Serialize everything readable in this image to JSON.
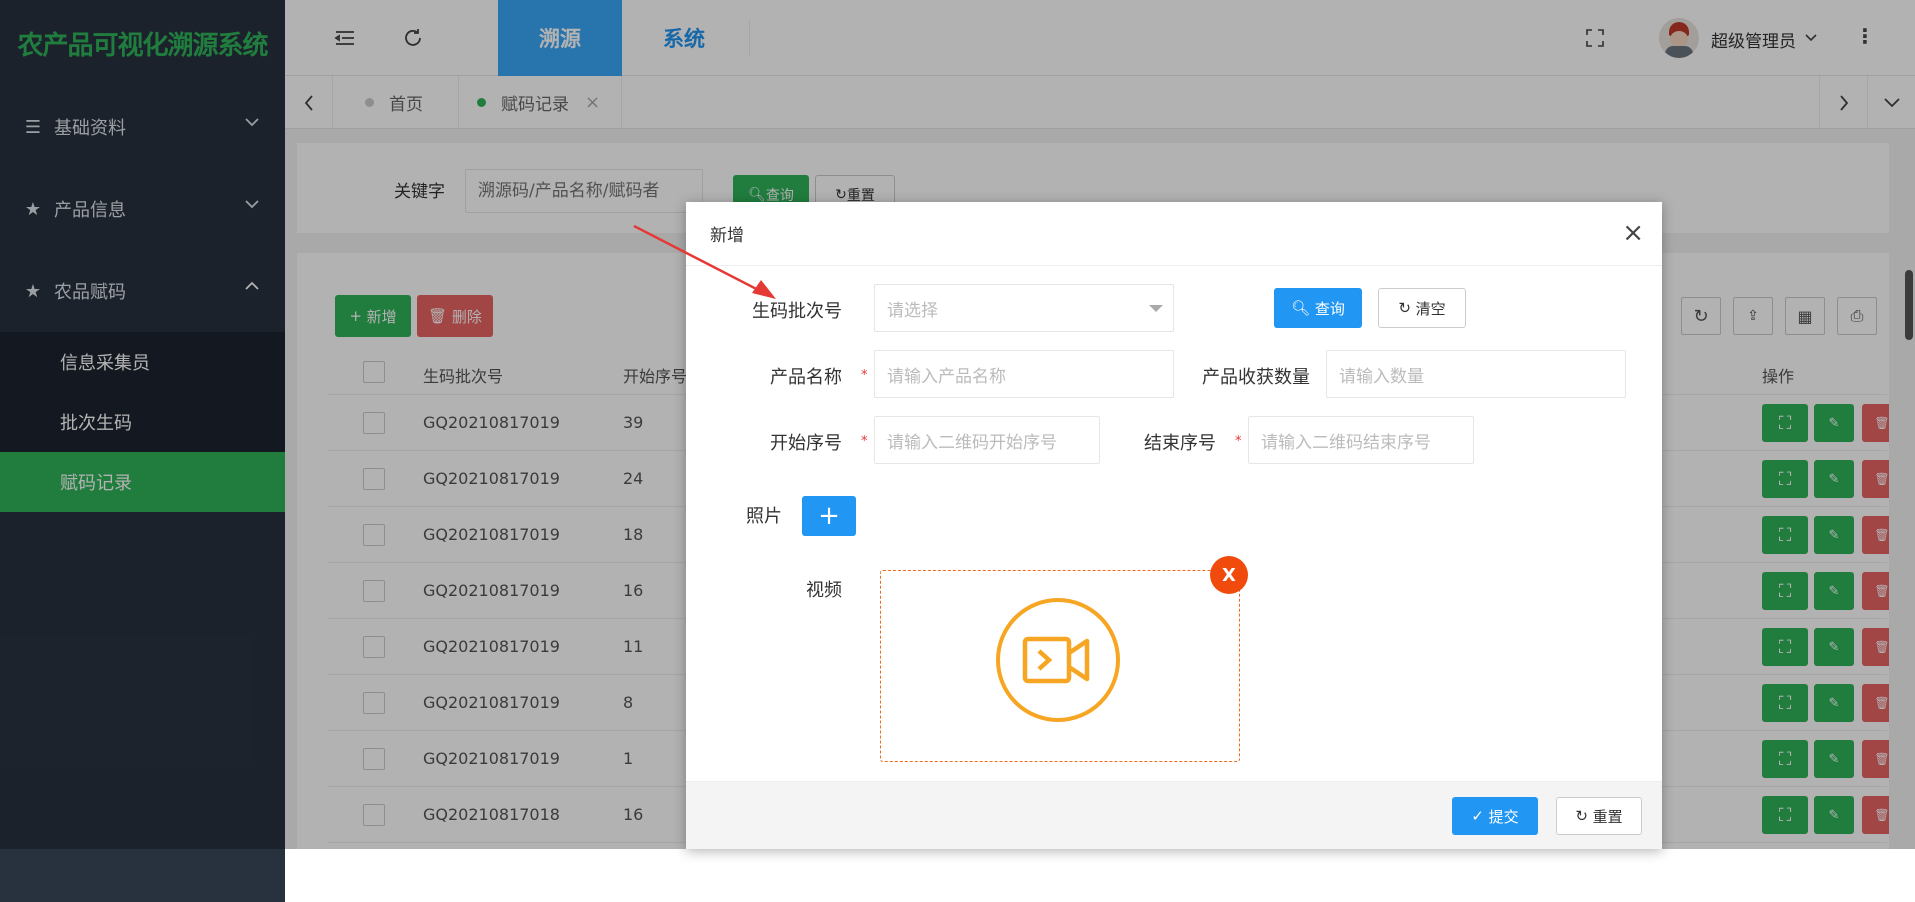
{
  "sidebar": {
    "title": "农产品可视化溯源系统",
    "menus": [
      {
        "label": "基础资料"
      },
      {
        "label": "产品信息"
      },
      {
        "label": "农品赋码"
      }
    ],
    "submenu": [
      {
        "label": "信息采集员"
      },
      {
        "label": "批次生码"
      },
      {
        "label": "赋码记录"
      }
    ]
  },
  "topbar": {
    "nav": [
      {
        "label": "溯源"
      },
      {
        "label": "系统"
      }
    ],
    "user": "超级管理员"
  },
  "tabs": [
    {
      "label": "首页"
    },
    {
      "label": "赋码记录"
    }
  ],
  "search": {
    "label": "关键字",
    "placeholder": "溯源码/产品名称/赋码者",
    "query": "查询",
    "reset": "重置"
  },
  "toolbar": {
    "add": "新增",
    "delete": "删除"
  },
  "table": {
    "headers": [
      "生码批次号",
      "开始序号",
      "操作"
    ],
    "rows": [
      {
        "batch": "GQ20210817019",
        "start": "39"
      },
      {
        "batch": "GQ20210817019",
        "start": "24"
      },
      {
        "batch": "GQ20210817019",
        "start": "18"
      },
      {
        "batch": "GQ20210817019",
        "start": "16"
      },
      {
        "batch": "GQ20210817019",
        "start": "11"
      },
      {
        "batch": "GQ20210817019",
        "start": "8"
      },
      {
        "batch": "GQ20210817019",
        "start": "1"
      },
      {
        "batch": "GQ20210817018",
        "start": "16"
      }
    ]
  },
  "modal": {
    "title": "新增",
    "batch_label": "生码批次号",
    "batch_placeholder": "请选择",
    "query": "查询",
    "clear": "清空",
    "product_label": "产品名称",
    "product_placeholder": "请输入产品名称",
    "qty_label": "产品收获数量",
    "qty_placeholder": "请输入数量",
    "start_label": "开始序号",
    "start_placeholder": "请输入二维码开始序号",
    "end_label": "结束序号",
    "end_placeholder": "请输入二维码结束序号",
    "photo_label": "照片",
    "video_label": "视频",
    "remove": "X",
    "submit": "提交",
    "reset": "重置"
  },
  "colors": {
    "green": "#2fb45a",
    "blue": "#2196f3",
    "red": "#e86464",
    "orange": "#f6a623",
    "annotation": "#e53935"
  }
}
